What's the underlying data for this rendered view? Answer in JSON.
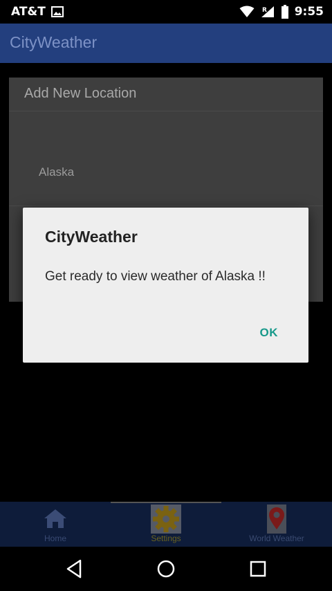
{
  "status_bar": {
    "carrier": "AT&T",
    "time": "9:55",
    "roaming_indicator": "R"
  },
  "app_bar": {
    "title": "CityWeather"
  },
  "add_location_dialog": {
    "title": "Add New Location",
    "location_text": "Alaska"
  },
  "alert_dialog": {
    "title": "CityWeather",
    "message": "Get ready to view weather of Alaska !!",
    "ok_label": "OK"
  },
  "tabs": [
    {
      "label": "Home",
      "icon": "home-icon"
    },
    {
      "label": "Settings",
      "icon": "gear-icon"
    },
    {
      "label": "World Weather",
      "icon": "map-pin-icon"
    }
  ],
  "colors": {
    "app_bar": "#233f7e",
    "accent": "#17998a",
    "tab_bar": "#0e1c3a"
  },
  "nav_bar": {
    "buttons": [
      "back-icon",
      "home-circle-icon",
      "recents-icon"
    ]
  }
}
